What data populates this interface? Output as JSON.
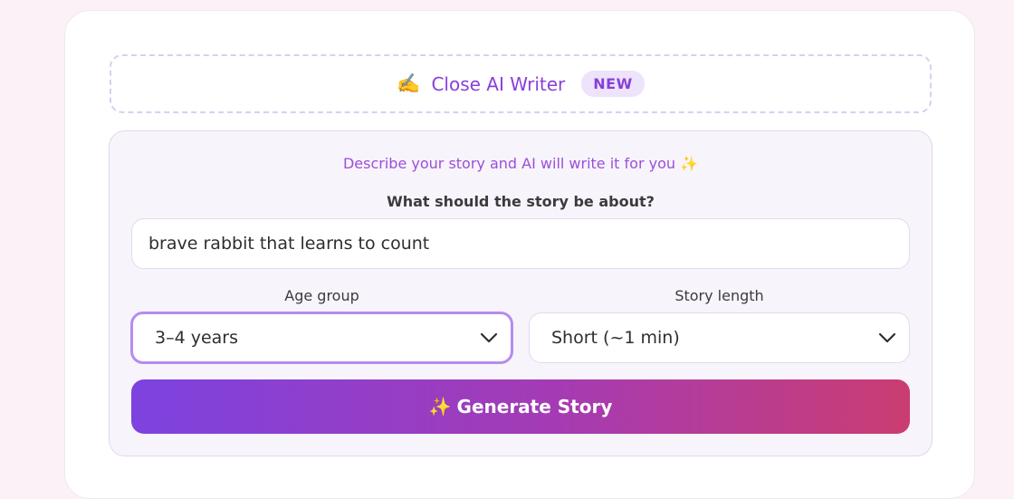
{
  "ai_writer": {
    "toggle_icon": "✍️",
    "toggle_label": "Close AI Writer",
    "badge": "NEW",
    "hint": "Describe your story and AI will write it for you ✨",
    "topic_label": "What should the story be about?",
    "topic_value": "brave rabbit that learns to count",
    "age_label": "Age group",
    "age_value": "3–4 years",
    "length_label": "Story length",
    "length_value": "Short (~1 min)",
    "generate_icon": "✨",
    "generate_label": "Generate Story"
  },
  "colors": {
    "accent": "#8a3fd8",
    "gradient_start": "#7d42e0",
    "gradient_end": "#cb3d72",
    "focus_border": "#b58cf0"
  }
}
